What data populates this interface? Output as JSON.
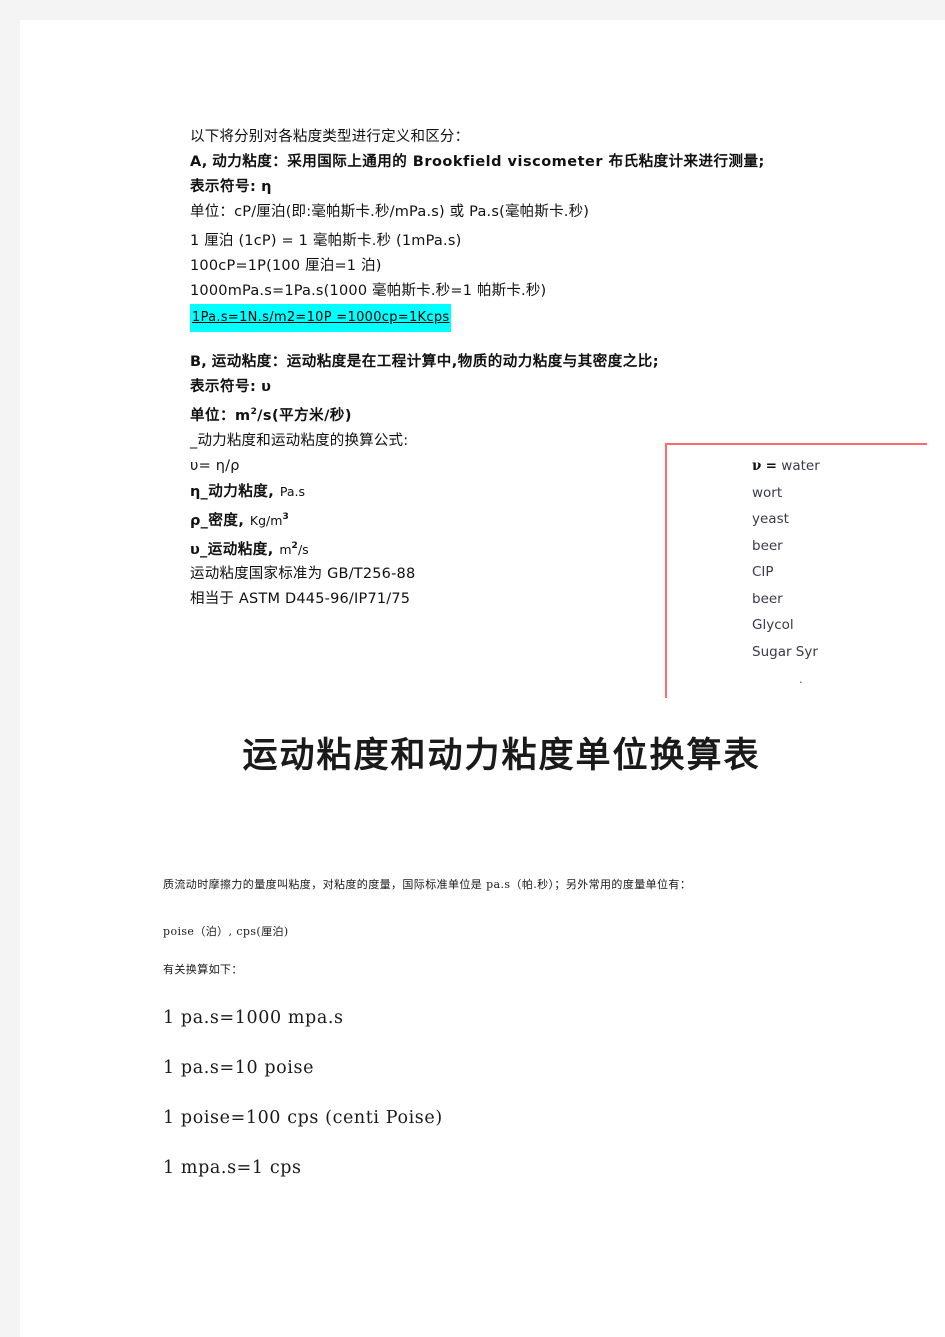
{
  "document": {
    "colors": {
      "page_background": "#ffffff",
      "outer_background": "#f4f4f4",
      "highlight": "#00ffff",
      "box_border": "#ff6b6b",
      "text": "#1a1a1a"
    },
    "intro_line": "以下将分别对各粘度类型进行定义和区分：",
    "section_a": {
      "heading_label": "A,",
      "heading_text": "动力粘度：采用国际上通用的 Brookfield viscometer 布氏粘度计来进行测量;",
      "symbol_line_label": "表示符号:",
      "symbol_line_value": "η",
      "unit_line": "单位：cP/厘泊(即:毫帕斯卡.秒/mPa.s) 或 Pa.s(毫帕斯卡.秒)",
      "conversions": [
        "1 厘泊 (1cP) = 1 毫帕斯卡.秒 (1mPa.s)",
        "100cP=1P(100 厘泊=1 泊)",
        "1000mPa.s=1Pa.s(1000 毫帕斯卡.秒=1 帕斯卡.秒)"
      ],
      "highlighted_conversion": "1Pa.s=1N.s/m2=10P =1000cp=1Kcps"
    },
    "section_b": {
      "heading_label": "B,",
      "heading_text": "运动粘度：运动粘度是在工程计算中,物质的动力粘度与其密度之比;",
      "symbol_line_label": "表示符号:",
      "symbol_line_value": "υ",
      "unit_line_prefix": "单位：m",
      "unit_line_sup": "2",
      "unit_line_suffix": "/s(平方米/秒)",
      "formula_intro": "_动力粘度和运动粘度的换算公式:",
      "formula": "υ= η/ρ",
      "legend": [
        {
          "symbol": "η",
          "text": "_动力粘度, ",
          "unit": "Pa.s",
          "sup": ""
        },
        {
          "symbol": "ρ",
          "text": "_密度, ",
          "unit": "Kg/m",
          "sup": "3"
        },
        {
          "symbol": "υ",
          "text": "_运动粘度, ",
          "unit": "m",
          "sup": "2",
          "unit_tail": "/s"
        }
      ],
      "standard_line": "运动粘度国家标准为 GB/T256-88",
      "equivalent_line": "相当于 ASTM D445-96/IP71/75"
    },
    "red_box": {
      "symbol": "ν",
      "equals": "=",
      "items": [
        "water",
        "wort",
        "yeast",
        "beer",
        "CIP",
        "beer",
        "Glycol",
        "Sugar Syr"
      ],
      "trailing_mark": "."
    },
    "title": "运动粘度和动力粘度单位换算表",
    "lower_section": {
      "paragraph_line_1": "质流动时摩擦力的量度叫粘度，对粘度的度量，国际标准单位是 pa.s（帕.秒）；另外常用的度量单位有：",
      "paragraph_line_2": "poise（泊）,    cps(厘泊)",
      "list_intro": "有关换算如下：",
      "conversions": [
        "1 pa.s=1000 mpa.s",
        "1 pa.s=10 poise",
        "1 poise=100 cps (centi Poise)",
        "1 mpa.s=1 cps"
      ]
    }
  }
}
